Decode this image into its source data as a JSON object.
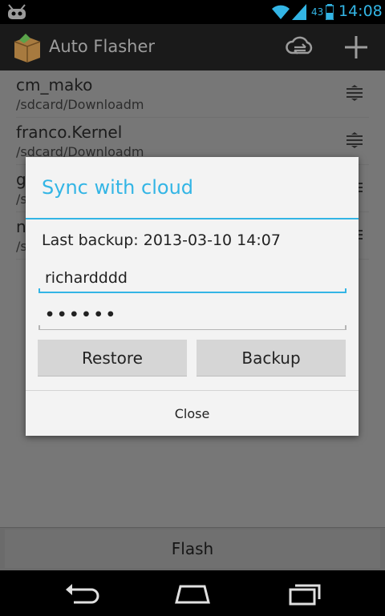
{
  "status_bar": {
    "battery_percent": "43",
    "time": "14:08",
    "accent_color": "#33b5e5"
  },
  "action_bar": {
    "title": "Auto Flasher",
    "icons": [
      "app-box-icon",
      "cloud-sync-icon",
      "add-icon"
    ]
  },
  "list": {
    "items": [
      {
        "name": "cm_mako",
        "path": "/sdcard/Downloadm"
      },
      {
        "name": "franco.Kernel",
        "path": "/sdcard/Downloadm"
      },
      {
        "name": "g",
        "path": "/s"
      },
      {
        "name": "n",
        "path": "/s"
      }
    ]
  },
  "flash_button": "Flash",
  "dialog": {
    "title": "Sync with cloud",
    "last_backup": "Last backup: 2013-03-10 14:07",
    "username_value": "richardddd",
    "password_value": "••••••",
    "restore_label": "Restore",
    "backup_label": "Backup",
    "close_label": "Close"
  },
  "nav": {
    "icons": [
      "back-icon",
      "home-icon",
      "recents-icon"
    ]
  }
}
